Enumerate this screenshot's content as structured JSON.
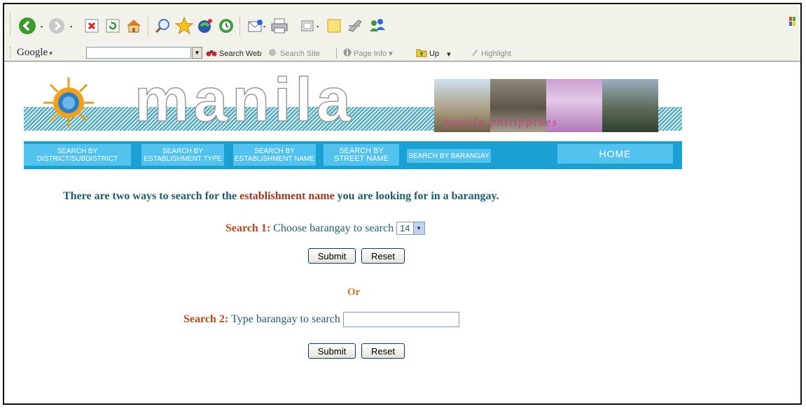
{
  "toolbar": {
    "icons": [
      "back-icon",
      "forward-icon",
      "stop-icon",
      "refresh-icon",
      "home-icon",
      "search-icon",
      "favorites-icon",
      "media-icon",
      "history-icon",
      "mail-icon",
      "print-icon",
      "edit-icon",
      "notes-icon",
      "messenger-icon",
      "contacts-icon"
    ]
  },
  "google_bar": {
    "logo": "Google",
    "search_web": "Search Web",
    "search_site": "Search Site",
    "page_info": "Page Info",
    "up": "Up",
    "highlight": "Highlight"
  },
  "banner": {
    "title": "manila",
    "photo_caption": "manila philippines"
  },
  "nav": {
    "district": [
      "SEARCH BY",
      "DISTRICT/SUBDISTRICT"
    ],
    "establishment_type": [
      "SEARCH BY",
      "ESTABLISHMENT TYPE"
    ],
    "establishment_name": [
      "SEARCH BY",
      "ESTABLISHMENT NAME"
    ],
    "street_name": [
      "SEARCH  BY",
      "STREET NAME"
    ],
    "barangay": "SEARCH  BY BARANGAY",
    "home": "HOME"
  },
  "content": {
    "headline_part1": "There are two ways to search for the ",
    "headline_highlight": "establishment name",
    "headline_part2": " you are looking for in a barangay.",
    "search1_label": "Search 1:",
    "search1_text": "Choose barangay to search",
    "search1_selected": "14",
    "submit": "Submit",
    "reset": "Reset",
    "or": "Or",
    "search2_label": "Search 2:",
    "search2_text": "Type barangay to search",
    "search2_value": ""
  }
}
